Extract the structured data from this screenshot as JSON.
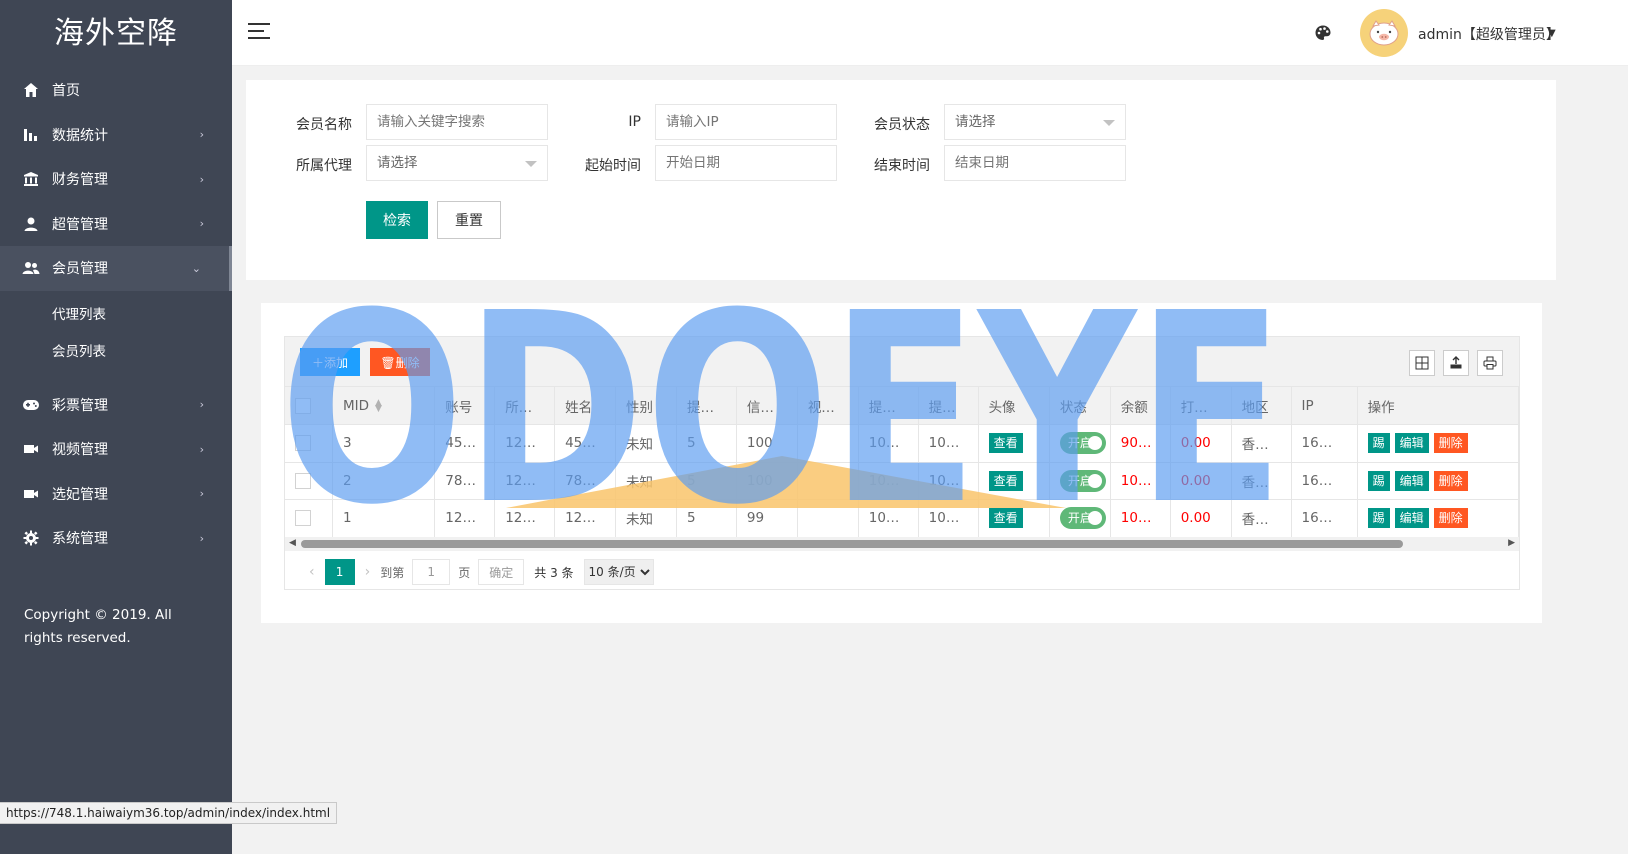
{
  "app": {
    "title": "海外空降"
  },
  "sidebar": {
    "items": [
      {
        "label": "首页",
        "icon": "home-icon"
      },
      {
        "label": "数据统计",
        "icon": "bar-chart-icon"
      },
      {
        "label": "财务管理",
        "icon": "bank-icon"
      },
      {
        "label": "超管管理",
        "icon": "user-icon"
      },
      {
        "label": "会员管理",
        "icon": "users-icon"
      },
      {
        "label": "彩票管理",
        "icon": "gamepad-icon"
      },
      {
        "label": "视频管理",
        "icon": "video-icon"
      },
      {
        "label": "选妃管理",
        "icon": "video-icon"
      },
      {
        "label": "系统管理",
        "icon": "gear-icon"
      }
    ],
    "subitems": [
      {
        "label": "代理列表"
      },
      {
        "label": "会员列表"
      }
    ],
    "copyright": "Copyright © 2019. All rights reserved."
  },
  "header": {
    "user": "admin【超级管理员】"
  },
  "search": {
    "fields": {
      "member_name_label": "会员名称",
      "member_name_placeholder": "请输入关键字搜索",
      "ip_label": "IP",
      "ip_placeholder": "请输入IP",
      "status_label": "会员状态",
      "status_value": "请选择",
      "agent_label": "所属代理",
      "agent_value": "请选择",
      "start_label": "起始时间",
      "start_placeholder": "开始日期",
      "end_label": "结束时间",
      "end_placeholder": "结束日期"
    },
    "search_label": "检索",
    "reset_label": "重置"
  },
  "toolbar": {
    "add_label": "添加",
    "delete_label": "删除"
  },
  "table": {
    "columns": [
      "",
      "MID",
      "账号",
      "所…",
      "姓名",
      "性别",
      "提…",
      "信…",
      "视…",
      "提…",
      "提…",
      "头像",
      "状态",
      "余额",
      "打…",
      "地区",
      "IP",
      "操作"
    ],
    "rows": [
      {
        "mid": "3",
        "account": "45…",
        "agent": "12…",
        "name": "45…",
        "gender": "未知",
        "c6": "5",
        "credit": "100",
        "video": "",
        "c9": "10…",
        "c10": "10…",
        "avatar_btn": "查看",
        "status": "开启",
        "balance": "90…",
        "c14": "0.00",
        "region": "香…",
        "ip": "16…"
      },
      {
        "mid": "2",
        "account": "78…",
        "agent": "12…",
        "name": "78…",
        "gender": "未知",
        "c6": "5",
        "credit": "100",
        "video": "",
        "c9": "10…",
        "c10": "10…",
        "avatar_btn": "查看",
        "status": "开启",
        "balance": "10…",
        "c14": "0.00",
        "region": "香…",
        "ip": "16…"
      },
      {
        "mid": "1",
        "account": "12…",
        "agent": "12…",
        "name": "12…",
        "gender": "未知",
        "c6": "5",
        "credit": "99",
        "video": "",
        "c9": "10…",
        "c10": "10…",
        "avatar_btn": "查看",
        "status": "开启",
        "balance": "10…",
        "c14": "0.00",
        "region": "香…",
        "ip": "16…"
      }
    ],
    "actions": {
      "a1": "踢",
      "a2": "编辑",
      "a3": "删除"
    }
  },
  "pager": {
    "current": "1",
    "goto_label": "到第",
    "goto_value": "1",
    "page_unit": "页",
    "confirm_label": "确定",
    "total": "共 3 条",
    "page_size": "10 条/页"
  },
  "watermark": {
    "text": "ODOEYE"
  },
  "statusbar": {
    "url": "https://748.1.haiwaiym36.top/admin/index/index.html"
  },
  "colors": {
    "sidebar": "#3f4654",
    "primary": "#009688",
    "blue": "#1e9fff",
    "danger": "#ff5722",
    "balance": "#ff0000",
    "switch": "#5fb878"
  }
}
